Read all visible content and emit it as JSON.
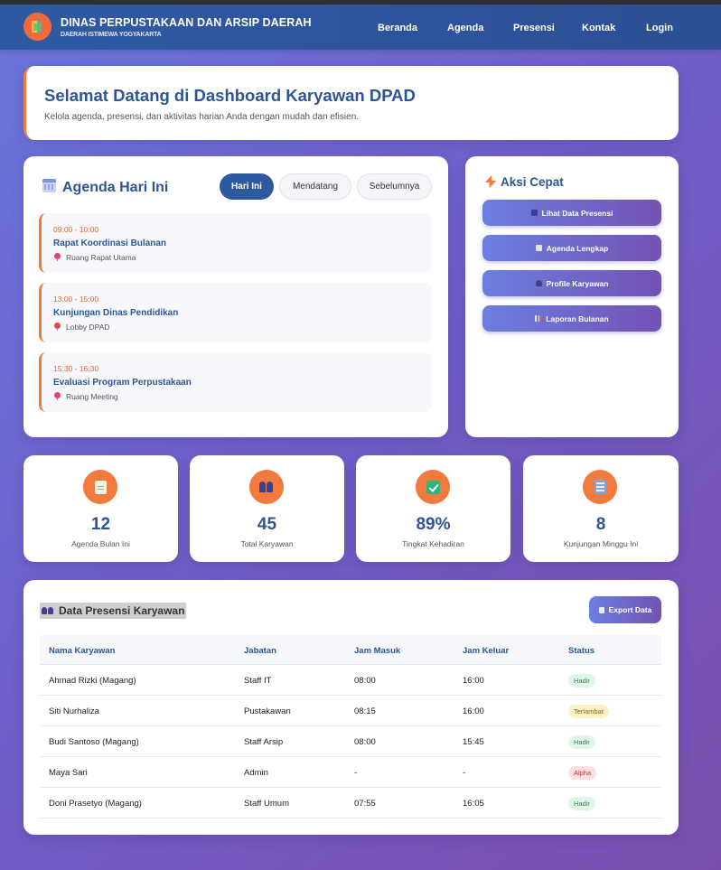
{
  "header": {
    "title": "DINAS PERPUSTAKAAN DAN ARSIP DAERAH",
    "subtitle": "DAERAH ISTIMEWA YOGYAKARTA",
    "nav": [
      {
        "label": "Beranda"
      },
      {
        "label": "Agenda"
      },
      {
        "label": "Presensi"
      },
      {
        "label": "Kontak"
      },
      {
        "label": "Login"
      }
    ]
  },
  "welcome": {
    "title": "Selamat Datang di Dashboard Karyawan DPAD",
    "subtitle": "Kelola agenda, presensi, dan aktivitas harian Anda dengan mudah dan efisien."
  },
  "agenda": {
    "title": "Agenda Hari Ini",
    "icon": "calendar-icon",
    "tabs": [
      {
        "label": "Hari Ini",
        "active": true
      },
      {
        "label": "Mendatang",
        "active": false
      },
      {
        "label": "Sebelumnya",
        "active": false
      }
    ],
    "items": [
      {
        "time": "09:00 - 10:00",
        "name": "Rapat Koordinasi Bulanan",
        "location": "Ruang Rapat Utama"
      },
      {
        "time": "13:00 - 15:00",
        "name": "Kunjungan Dinas Pendidikan",
        "location": "Lobby DPAD"
      },
      {
        "time": "15:30 - 16:30",
        "name": "Evaluasi Program Perpustakaan",
        "location": "Ruang Meeting"
      }
    ]
  },
  "quick_actions": {
    "title": "Aksi Cepat",
    "icon": "lightning-icon",
    "buttons": [
      {
        "label": "Lihat Data Presensi",
        "icon": "users-icon"
      },
      {
        "label": "Agenda Lengkap",
        "icon": "clipboard-icon"
      },
      {
        "label": "Profile Karyawan",
        "icon": "person-icon"
      },
      {
        "label": "Laporan Bulanan",
        "icon": "chart-icon"
      }
    ]
  },
  "stats": [
    {
      "value": "12",
      "label": "Agenda Bulan Ini",
      "icon": "clipboard-icon"
    },
    {
      "value": "45",
      "label": "Total Karyawan",
      "icon": "users-icon"
    },
    {
      "value": "89%",
      "label": "Tingkat Kehadiran",
      "icon": "check-icon"
    },
    {
      "value": "8",
      "label": "Kunjungan Minggu Ini",
      "icon": "building-icon"
    }
  ],
  "attendance": {
    "title": "Data Presensi Karyawan",
    "export_label": "Export Data",
    "columns": [
      "Nama Karyawan",
      "Jabatan",
      "Jam Masuk",
      "Jam Keluar",
      "Status"
    ],
    "rows": [
      {
        "name": "Ahmad Rizki (Magang)",
        "position": "Staff IT",
        "in": "08:00",
        "out": "16:00",
        "status": "Hadir"
      },
      {
        "name": "Siti Nurhaliza",
        "position": "Pustakawan",
        "in": "08:15",
        "out": "16:00",
        "status": "Terlambat"
      },
      {
        "name": "Budi Santoso (Magang)",
        "position": "Staff Arsip",
        "in": "08:00",
        "out": "15:45",
        "status": "Hadir"
      },
      {
        "name": "Maya Sari",
        "position": "Admin",
        "in": "-",
        "out": "-",
        "status": "Alpha"
      },
      {
        "name": "Doni Prasetyo (Magang)",
        "position": "Staff Umum",
        "in": "07:55",
        "out": "16:05",
        "status": "Hadir"
      }
    ]
  },
  "colors": {
    "primary": "#2c5596",
    "accent": "#f27a3e",
    "status_hadir": "#2b8a4c",
    "status_terlambat": "#8a6a10",
    "status_alpha": "#b3303f"
  }
}
